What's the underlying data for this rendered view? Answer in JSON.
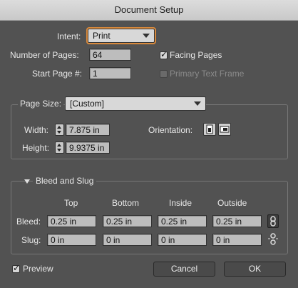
{
  "window": {
    "title": "Document Setup"
  },
  "intent": {
    "label": "Intent:",
    "value": "Print"
  },
  "pages": {
    "number_label": "Number of Pages:",
    "number_value": "64",
    "start_label": "Start Page #:",
    "start_value": "1"
  },
  "options": {
    "facing_pages": "Facing Pages",
    "primary_text_frame": "Primary Text Frame"
  },
  "page_size": {
    "label": "Page Size:",
    "value": "[Custom]",
    "width_label": "Width:",
    "width_value": "7.875 in",
    "height_label": "Height:",
    "height_value": "9.9375 in",
    "orientation_label": "Orientation:"
  },
  "bleed_slug": {
    "title": "Bleed and Slug",
    "columns": [
      "Top",
      "Bottom",
      "Inside",
      "Outside"
    ],
    "bleed_label": "Bleed:",
    "bleed_values": [
      "0.25 in",
      "0.25 in",
      "0.25 in",
      "0.25 in"
    ],
    "slug_label": "Slug:",
    "slug_values": [
      "0 in",
      "0 in",
      "0 in",
      "0 in"
    ]
  },
  "footer": {
    "preview": "Preview",
    "cancel": "Cancel",
    "ok": "OK"
  },
  "icons": {
    "check": "✓"
  }
}
